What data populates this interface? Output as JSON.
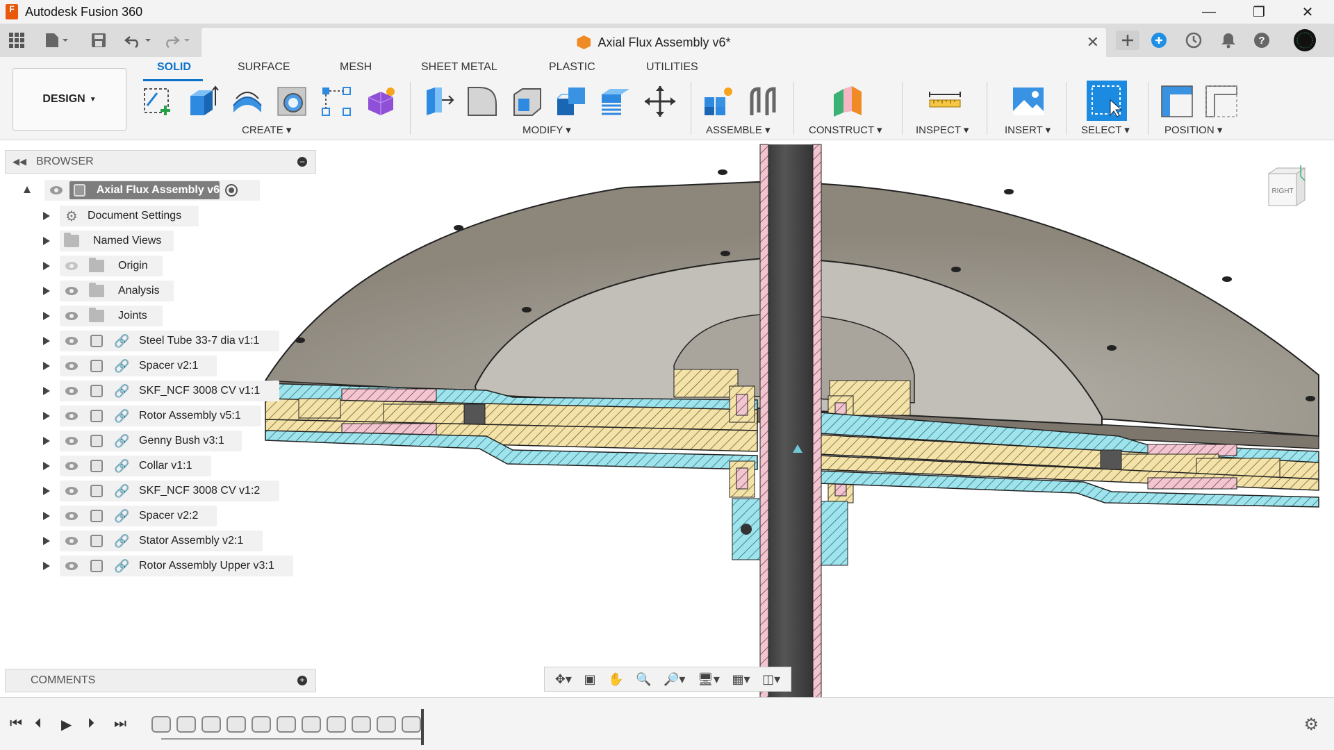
{
  "window": {
    "app_title": "Autodesk Fusion 360",
    "app_icon_letter": "F"
  },
  "document": {
    "tab_title": "Axial Flux Assembly v6*"
  },
  "ribbon": {
    "workspace": "DESIGN",
    "tabs": [
      {
        "label": "SOLID",
        "active": true
      },
      {
        "label": "SURFACE",
        "active": false
      },
      {
        "label": "MESH",
        "active": false
      },
      {
        "label": "SHEET METAL",
        "active": false
      },
      {
        "label": "PLASTIC",
        "active": false
      },
      {
        "label": "UTILITIES",
        "active": false
      }
    ],
    "groups": [
      {
        "label": "CREATE"
      },
      {
        "label": "MODIFY"
      },
      {
        "label": "ASSEMBLE"
      },
      {
        "label": "CONSTRUCT"
      },
      {
        "label": "INSPECT"
      },
      {
        "label": "INSERT"
      },
      {
        "label": "SELECT"
      },
      {
        "label": "POSITION"
      }
    ]
  },
  "browser": {
    "title": "BROWSER",
    "root": "Axial Flux Assembly v6",
    "items": [
      {
        "label": "Document Settings",
        "icon": "gear-icon"
      },
      {
        "label": "Named Views",
        "icon": "folder-icon"
      },
      {
        "label": "Origin",
        "icon": "folder-icon",
        "hidden": true
      },
      {
        "label": "Analysis",
        "icon": "folder-icon"
      },
      {
        "label": "Joints",
        "icon": "folder-icon"
      },
      {
        "label": "Steel Tube 33-7 dia v1:1",
        "icon": "component-icon"
      },
      {
        "label": "Spacer v2:1",
        "icon": "component-icon"
      },
      {
        "label": "SKF_NCF 3008 CV v1:1",
        "icon": "component-icon"
      },
      {
        "label": "Rotor Assembly v5:1",
        "icon": "component-icon"
      },
      {
        "label": "Genny Bush v3:1",
        "icon": "component-icon"
      },
      {
        "label": "Collar v1:1",
        "icon": "component-icon"
      },
      {
        "label": "SKF_NCF 3008 CV v1:2",
        "icon": "component-icon"
      },
      {
        "label": "Spacer v2:2",
        "icon": "component-icon"
      },
      {
        "label": "Stator Assembly v2:1",
        "icon": "component-icon"
      },
      {
        "label": "Rotor Assembly Upper v3:1",
        "icon": "component-icon"
      }
    ]
  },
  "comments": {
    "label": "COMMENTS"
  },
  "viewcube": {
    "face": "RIGHT"
  },
  "colors": {
    "accent": "#0a72c9",
    "section_cyan": "#9fe3ec",
    "section_yellow": "#f3e2a9",
    "section_pink": "#f2c6d1",
    "body_gray": "#8e887d"
  }
}
